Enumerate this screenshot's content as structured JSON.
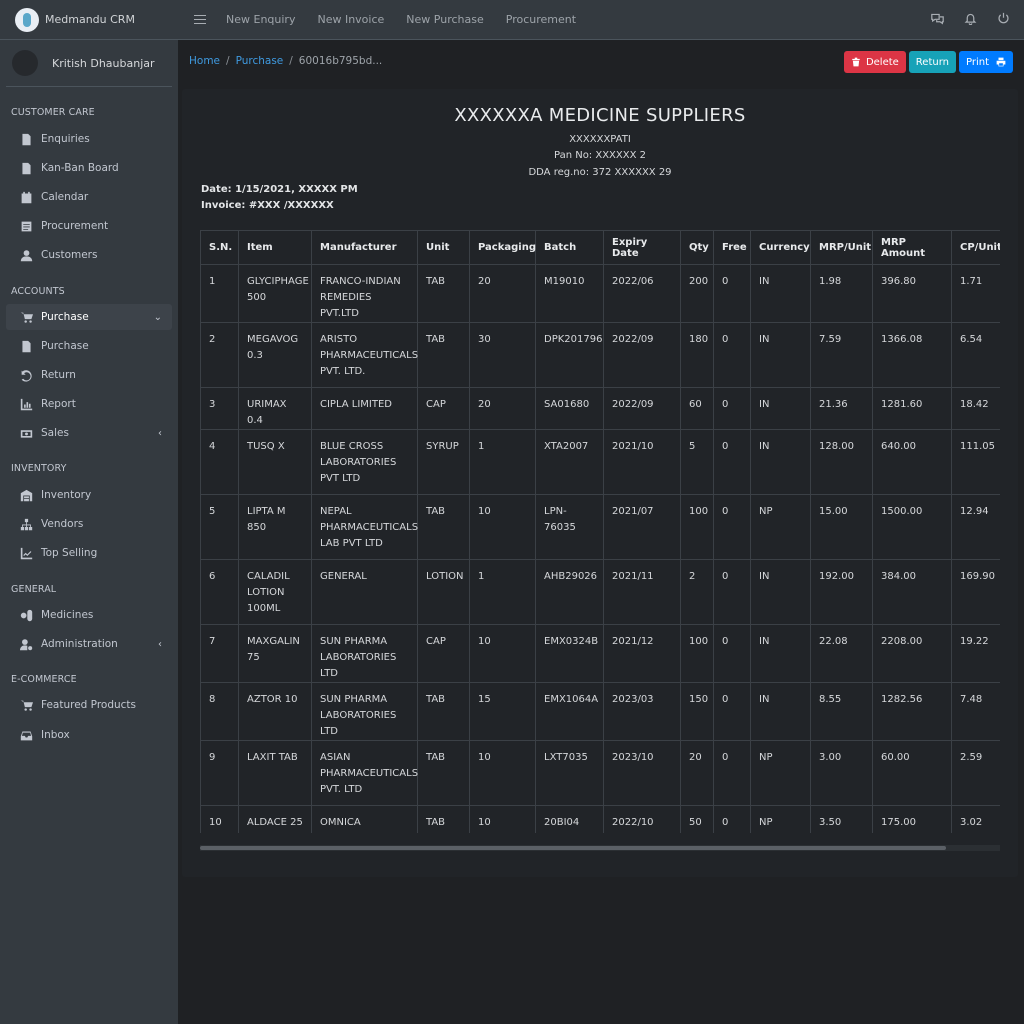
{
  "brand": {
    "name": "Medmandu CRM"
  },
  "user": {
    "name": "Kritish Dhaubanjar"
  },
  "sidebar": {
    "sections": [
      {
        "header": "CUSTOMER CARE"
      },
      {
        "header": "ACCOUNTS"
      },
      {
        "header": "INVENTORY"
      },
      {
        "header": "GENERAL"
      },
      {
        "header": "E-COMMERCE"
      }
    ],
    "items": [
      {
        "label": "Enquiries",
        "icon": "file-icon"
      },
      {
        "label": "Kan-Ban Board",
        "icon": "file-icon"
      },
      {
        "label": "Calendar",
        "icon": "calendar-icon"
      },
      {
        "label": "Procurement",
        "icon": "list-icon"
      },
      {
        "label": "Customers",
        "icon": "user-icon"
      },
      {
        "label": "Purchase",
        "icon": "cart-icon",
        "active": true
      },
      {
        "label": "Purchase",
        "icon": "file-icon"
      },
      {
        "label": "Return",
        "icon": "undo-icon"
      },
      {
        "label": "Report",
        "icon": "chart-icon"
      },
      {
        "label": "Sales",
        "icon": "money-icon"
      },
      {
        "label": "Inventory",
        "icon": "warehouse-icon"
      },
      {
        "label": "Vendors",
        "icon": "sitemap-icon"
      },
      {
        "label": "Top Selling",
        "icon": "trend-icon"
      },
      {
        "label": "Medicines",
        "icon": "pills-icon"
      },
      {
        "label": "Administration",
        "icon": "user-cog-icon"
      },
      {
        "label": "Featured Products",
        "icon": "cart-icon"
      },
      {
        "label": "Inbox",
        "icon": "inbox-icon"
      }
    ]
  },
  "topbar": {
    "links": [
      "New Enquiry",
      "New Invoice",
      "New Purchase",
      "Procurement"
    ]
  },
  "breadcrumb": {
    "home": "Home",
    "section": "Purchase",
    "current": "60016b795bd..."
  },
  "actions": {
    "delete": "Delete",
    "return": "Return",
    "print": "Print"
  },
  "invoice": {
    "title": "XXXXXXA MEDICINE SUPPLIERS",
    "address": "XXXXXXPATI",
    "pan": "Pan No:  XXXXXX 2",
    "dda": "DDA reg.no: 372 XXXXXX 29",
    "date": "Date: 1/15/2021, XXXXX PM",
    "invoice_no": "Invoice: #XXX  /XXXXXX"
  },
  "table": {
    "headers": [
      "S.N.",
      "Item",
      "Manufacturer",
      "Unit",
      "Packaging",
      "Batch",
      "Expiry Date",
      "Qty",
      "Free",
      "Currency",
      "MRP/Unit",
      "MRP Amount",
      "CP/Unit"
    ],
    "rows": [
      [
        "1",
        "GLYCIPHAGE 500",
        "FRANCO-INDIAN REMEDIES PVT.LTD",
        "TAB",
        "20",
        "M19010",
        "2022/06",
        "200",
        "0",
        "IN",
        "1.98",
        "396.80",
        "1.71"
      ],
      [
        "2",
        "MEGAVOG 0.3",
        "ARISTO PHARMACEUTICALS PVT. LTD.",
        "TAB",
        "30",
        "DPK201796",
        "2022/09",
        "180",
        "0",
        "IN",
        "7.59",
        "1366.08",
        "6.54"
      ],
      [
        "3",
        "URIMAX 0.4",
        "CIPLA LIMITED",
        "CAP",
        "20",
        "SA01680",
        "2022/09",
        "60",
        "0",
        "IN",
        "21.36",
        "1281.60",
        "18.42"
      ],
      [
        "4",
        "TUSQ X",
        "BLUE CROSS LABORATORIES PVT LTD",
        "SYRUP",
        "1",
        "XTA2007",
        "2021/10",
        "5",
        "0",
        "IN",
        "128.00",
        "640.00",
        "111.05"
      ],
      [
        "5",
        "LIPTA M 850",
        "NEPAL PHARMACEUTICALS LAB PVT LTD",
        "TAB",
        "10",
        "LPN-76035",
        "2021/07",
        "100",
        "0",
        "NP",
        "15.00",
        "1500.00",
        "12.94"
      ],
      [
        "6",
        "CALADIL LOTION 100ML",
        "GENERAL",
        "LOTION",
        "1",
        "AHB29026",
        "2021/11",
        "2",
        "0",
        "IN",
        "192.00",
        "384.00",
        "169.90"
      ],
      [
        "7",
        "MAXGALIN 75",
        "SUN PHARMA LABORATORIES LTD",
        "CAP",
        "10",
        "EMX0324B",
        "2021/12",
        "100",
        "0",
        "IN",
        "22.08",
        "2208.00",
        "19.22"
      ],
      [
        "8",
        "AZTOR 10",
        "SUN PHARMA LABORATORIES LTD",
        "TAB",
        "15",
        "EMX1064A",
        "2023/03",
        "150",
        "0",
        "IN",
        "8.55",
        "1282.56",
        "7.48"
      ],
      [
        "9",
        "LAXIT TAB",
        "ASIAN PHARMACEUTICALS PVT. LTD",
        "TAB",
        "10",
        "LXT7035",
        "2023/10",
        "20",
        "0",
        "NP",
        "3.00",
        "60.00",
        "2.59"
      ],
      [
        "10",
        "ALDACE 25",
        "OMNICA LABORATORIES PVT LTD",
        "TAB",
        "10",
        "20BI04",
        "2022/10",
        "50",
        "0",
        "NP",
        "3.50",
        "175.00",
        "3.02"
      ]
    ]
  },
  "colors": {
    "delete": "#dc3545",
    "return": "#17a2b8",
    "print": "#007bff",
    "link": "#3f9ae0"
  }
}
